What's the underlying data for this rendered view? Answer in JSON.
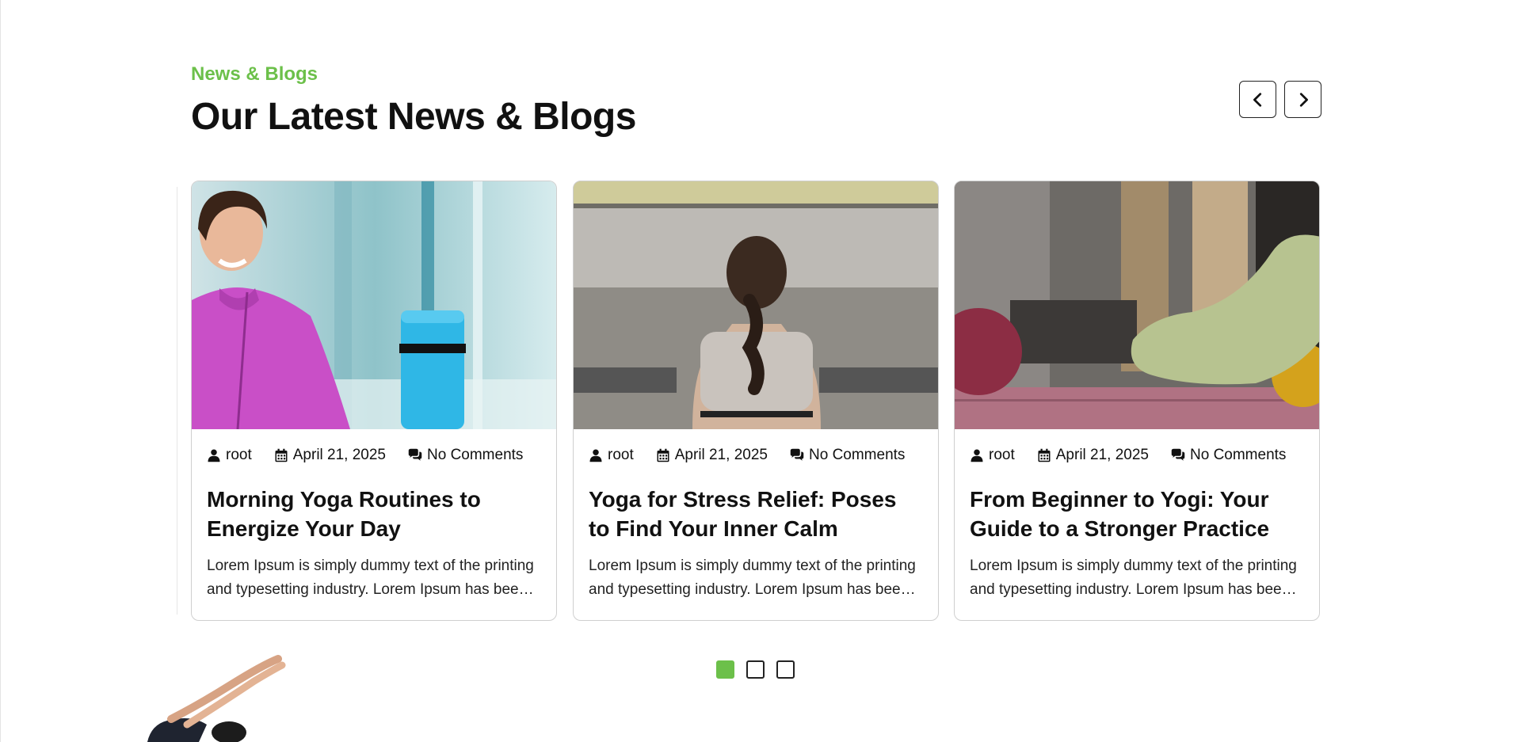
{
  "section": {
    "eyebrow": "News & Blogs",
    "title": "Our Latest News & Blogs"
  },
  "navigation": {
    "prev_icon": "chevron-left-icon",
    "next_icon": "chevron-right-icon"
  },
  "cards": [
    {
      "author": "root",
      "date": "April 21, 2025",
      "comments": "No Comments",
      "title": "Morning Yoga Routines to Energize Your Day",
      "excerpt": "Lorem Ipsum is simply dummy text of the printing and typesetting industry. Lorem Ipsum has been the industry's standard dummy text."
    },
    {
      "author": "root",
      "date": "April 21, 2025",
      "comments": "No Comments",
      "title": "Yoga for Stress Relief: Poses to Find Your Inner Calm",
      "excerpt": "Lorem Ipsum is simply dummy text of the printing and typesetting industry. Lorem Ipsum has been the industry's standard dummy text."
    },
    {
      "author": "root",
      "date": "April 21, 2025",
      "comments": "No Comments",
      "title": "From Beginner to Yogi: Your Guide to a Stronger Practice",
      "excerpt": "Lorem Ipsum is simply dummy text of the printing and typesetting industry. Lorem Ipsum has been the industry's standard dummy text."
    }
  ],
  "pagination": {
    "active_index": 0,
    "count": 3
  },
  "colors": {
    "accent": "#6cc04a",
    "text": "#111111",
    "border": "#cfcfcf"
  }
}
